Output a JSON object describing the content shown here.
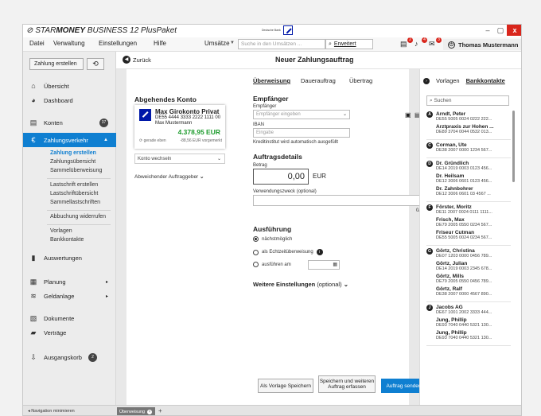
{
  "app": {
    "brand_prefix": "STAR",
    "brand_bold": "MONEY",
    "brand_suffix": " BUSINESS 12 PlusPaket",
    "bank_logo_text": "Deutsche Bank"
  },
  "menu": {
    "items": [
      "Datei",
      "Verwaltung",
      "Einstellungen",
      "Hilfe"
    ],
    "umsaetze": "Umsätze",
    "search_placeholder": "Suche in den Umsätzen ...",
    "search_button": "Erweitert",
    "badges": [
      "2",
      "4",
      "3"
    ],
    "user": "Thomas Mustermann"
  },
  "nav": {
    "zahlung_button": "Zahlung erstellen",
    "refresh_icon": "⟲",
    "items": [
      {
        "label": "Übersicht",
        "icon": "⌂"
      },
      {
        "label": "Dashboard",
        "icon": "◕"
      },
      {
        "label": "Konten",
        "icon": "▤",
        "badge": "37"
      },
      {
        "label": "Zahlungsverkehr",
        "icon": "€"
      }
    ],
    "zv_sub_1": [
      "Zahlung erstellen",
      "Zahlungsübersicht",
      "Sammelüberweisung"
    ],
    "zv_sub_2": [
      "Lastschrift erstellen",
      "Lastschriftübersicht",
      "Sammellastschriften"
    ],
    "zv_sub_3": [
      "Abbuchung widerrufen"
    ],
    "zv_sub_4": [
      "Vorlagen",
      "Bankkontakte"
    ],
    "items2": [
      {
        "label": "Auswertungen",
        "icon": "▮"
      },
      {
        "label": "Planung",
        "icon": "▦"
      },
      {
        "label": "Geldanlage",
        "icon": "≋"
      },
      {
        "label": "Dokumente",
        "icon": "▧"
      },
      {
        "label": "Verträge",
        "icon": "▰"
      },
      {
        "label": "Ausgangskorb",
        "icon": "⇩",
        "badge": "2"
      }
    ],
    "minimize": "Navigation minimieren"
  },
  "header": {
    "back": "Zurück",
    "title": "Neuer Zahlungsauftrag"
  },
  "account": {
    "section_title": "Abgehendes Konto",
    "name": "Max Girokonto Privat",
    "iban": "DE55 4444 3333 2222 1111 00",
    "owner": "Max Mustermann",
    "balance": "4.378,95 EUR",
    "updated": "gerade eben",
    "prebooked": "-88,56 EUR vorgemerkt",
    "switch": "Konto wechseln",
    "other_sender": "Abweichender Auftraggeber"
  },
  "tabs": [
    "Überweisung",
    "Dauerauftrag",
    "Übertrag"
  ],
  "form": {
    "recipient_title": "Empfänger",
    "recipient_label": "Empfänger",
    "recipient_placeholder": "Empfänger eingeben",
    "iban_label": "IBAN",
    "iban_placeholder": "Eingabe",
    "bank_note": "Kreditinstitut wird automatisch ausgefüllt",
    "details_title": "Auftragsdetails",
    "amount_label": "Betrag",
    "amount_value": "0,00",
    "currency": "EUR",
    "purpose_label": "Verwendungszweck (optional)",
    "purpose_counter": "0/140",
    "exec_title": "Ausführung",
    "exec_options": [
      "nächstmöglich",
      "als Echtzeitüberweisung",
      "ausführen am"
    ],
    "more_settings": "Weitere Einstellungen",
    "more_settings_suffix": "(optional)",
    "btn_template": "Als Vorlage Speichern",
    "btn_save_more": "Speichern und weiteren Auftrag erfassen",
    "btn_send": "Auftrag senden"
  },
  "contacts": {
    "tab_templates": "Vorlagen",
    "tab_contacts": "Bankkontakte",
    "search_placeholder": "Suchen",
    "groups": [
      {
        "letter": "A",
        "entries": [
          {
            "name": "Arndt, Peter",
            "iban": "DE55 5005 0024 0222 222..."
          },
          {
            "name": "Arztpraxis zur Hohen ...",
            "iban": "DE89 3704 0044 0532 013..."
          }
        ]
      },
      {
        "letter": "C",
        "entries": [
          {
            "name": "Corman, Ute",
            "iban": "DE38 2007 0000 1234 567..."
          }
        ]
      },
      {
        "letter": "D",
        "entries": [
          {
            "name": "Dr. Gründlich",
            "iban": "DE14 2019 0003 0123 456..."
          },
          {
            "name": "Dr. Heilsam",
            "iban": "DE12 3006 0601 0123 456..."
          },
          {
            "name": "Dr. Zahnbohrer",
            "iban": "DE12 3006 0601 03 4567 ..."
          }
        ]
      },
      {
        "letter": "F",
        "entries": [
          {
            "name": "Förster, Moritz",
            "iban": "DE11 2007 0024 0111 1111..."
          },
          {
            "name": "Frisch, Max",
            "iban": "DE79 2005 0550 0234 567..."
          },
          {
            "name": "Friseur Cutman",
            "iban": "DE55 5005 0024 0234 567..."
          }
        ]
      },
      {
        "letter": "G",
        "entries": [
          {
            "name": "Görtz, Christina",
            "iban": "DE07 1203 0000 0456 789..."
          },
          {
            "name": "Görtz, Julian",
            "iban": "DE14 2019 0003 2345 678..."
          },
          {
            "name": "Görtz, Mills",
            "iban": "DE79 2005 0550 0456 789..."
          },
          {
            "name": "Görtz, Ralf",
            "iban": "DE38 2007 0000 4567 890..."
          }
        ]
      },
      {
        "letter": "J",
        "entries": [
          {
            "name": "Jacobs AG",
            "iban": "DE67 1001 2002 3333 444..."
          },
          {
            "name": "Jung, Phillip",
            "iban": "DE93 7040 0440 5321 130..."
          },
          {
            "name": "Jung, Phillip",
            "iban": "DE93 7040 0440 5321 130..."
          }
        ]
      }
    ]
  },
  "bottom": {
    "tab": "Überweisung",
    "add": "+"
  }
}
